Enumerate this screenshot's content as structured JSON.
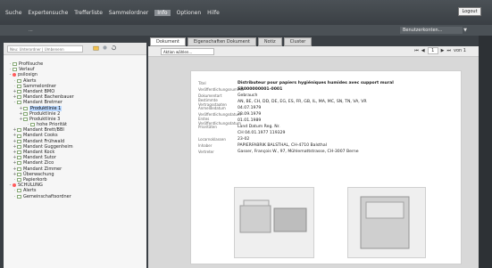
{
  "topbar": {
    "menu": [
      "Suche",
      "Expertensuche",
      "Trefferliste",
      "Sammelordner",
      "Info",
      "Optionen",
      "Hilfe"
    ],
    "active_index": 4,
    "logout_label": "Logout"
  },
  "band2": {
    "placeholder": "...",
    "right_select": "Benutzerkonten..."
  },
  "left": {
    "search_placeholder": "Neu: Unterordner | Umbenenn",
    "tree": [
      {
        "level": 0,
        "label": "Profilsuche",
        "sym": "o"
      },
      {
        "level": 0,
        "label": "Verlauf",
        "sym": "o"
      },
      {
        "level": 0,
        "label": "psilosign",
        "sym": "-"
      },
      {
        "level": 1,
        "label": "Alerts",
        "sym": "o"
      },
      {
        "level": 1,
        "label": "Sammelordner",
        "sym": "o"
      },
      {
        "level": 1,
        "label": "Mandant BMO",
        "sym": "+"
      },
      {
        "level": 1,
        "label": "Mandant Bachenbauer",
        "sym": "+"
      },
      {
        "level": 1,
        "label": "Mandant Bretmer",
        "sym": "-"
      },
      {
        "level": 2,
        "label": "Produktlinie 1",
        "sym": "+",
        "selected": true
      },
      {
        "level": 2,
        "label": "Produktlinie 2",
        "sym": "+"
      },
      {
        "level": 2,
        "label": "Produktlinie 3",
        "sym": "+"
      },
      {
        "level": 3,
        "label": "hohe Priorität",
        "sym": "o"
      },
      {
        "level": 1,
        "label": "Mandant Brett/BBI",
        "sym": "+"
      },
      {
        "level": 1,
        "label": "Mandant Cooks",
        "sym": "+"
      },
      {
        "level": 1,
        "label": "Mandant Frühwald",
        "sym": "+"
      },
      {
        "level": 1,
        "label": "Mandant Guggenheim",
        "sym": "+"
      },
      {
        "level": 1,
        "label": "Mandant Kock",
        "sym": "+"
      },
      {
        "level": 1,
        "label": "Mandant Sutor",
        "sym": "+"
      },
      {
        "level": 1,
        "label": "Mandant Zico",
        "sym": "+"
      },
      {
        "level": 1,
        "label": "Mandant Zimmer",
        "sym": "+"
      },
      {
        "level": 1,
        "label": "Überwachung",
        "sym": "+"
      },
      {
        "level": 1,
        "label": "Papierkorb",
        "sym": "o"
      },
      {
        "level": 0,
        "label": "SCHULUNG",
        "sym": "-"
      },
      {
        "level": 1,
        "label": "Alerts",
        "sym": "o"
      },
      {
        "level": 1,
        "label": "Gemeinschaftsordner",
        "sym": "o"
      }
    ]
  },
  "mid": {
    "tabs": [
      "Dokument",
      "Eigenschaften Dokument",
      "Notiz",
      "Cluster"
    ],
    "active_tab": 0,
    "action_placeholder": "Aktion wählen...",
    "pager_current": "1",
    "pager_of": "von 1"
  },
  "card": {
    "title_label": "Titel",
    "title_value": "Distributeur pour papiers hygiéniques humides avec support mural",
    "pubnum_label": "Veröffentlichungsnummer",
    "pubnum_value": "SR000000001-0001",
    "rows": [
      {
        "k": "Dokumentart",
        "v": "Gebrauch"
      },
      {
        "k": "Bestimmte Vertragsstaaten",
        "v": "AN, BE, CH, DD, DE, EG, ES, FR, GB, IL, MA, MC, SN, TN, VA, VR"
      },
      {
        "k": "Anmeldedatum",
        "v": "04.07.1979"
      },
      {
        "k": "Veröffentlichungsdatum",
        "v": "28.09.1979"
      },
      {
        "k": "Erstes Veröffentlichungsdatum",
        "v": "01.01.1989"
      },
      {
        "k": "Prioritäten",
        "v": "Land   Datum   Reg. Nr."
      },
      {
        "k": "",
        "v": "CH   04.01.1977   119329"
      },
      {
        "k": "Locarnoklassen",
        "v": "23-02"
      },
      {
        "k": "Inhaber",
        "v": "PAPIERFABRIK BALSTHAL, CH-4710 Balsthal"
      },
      {
        "k": "Vertreter",
        "v": "Gasser, François W., 97, Mühlemattstrasse, CH-3007 Berne"
      }
    ]
  }
}
